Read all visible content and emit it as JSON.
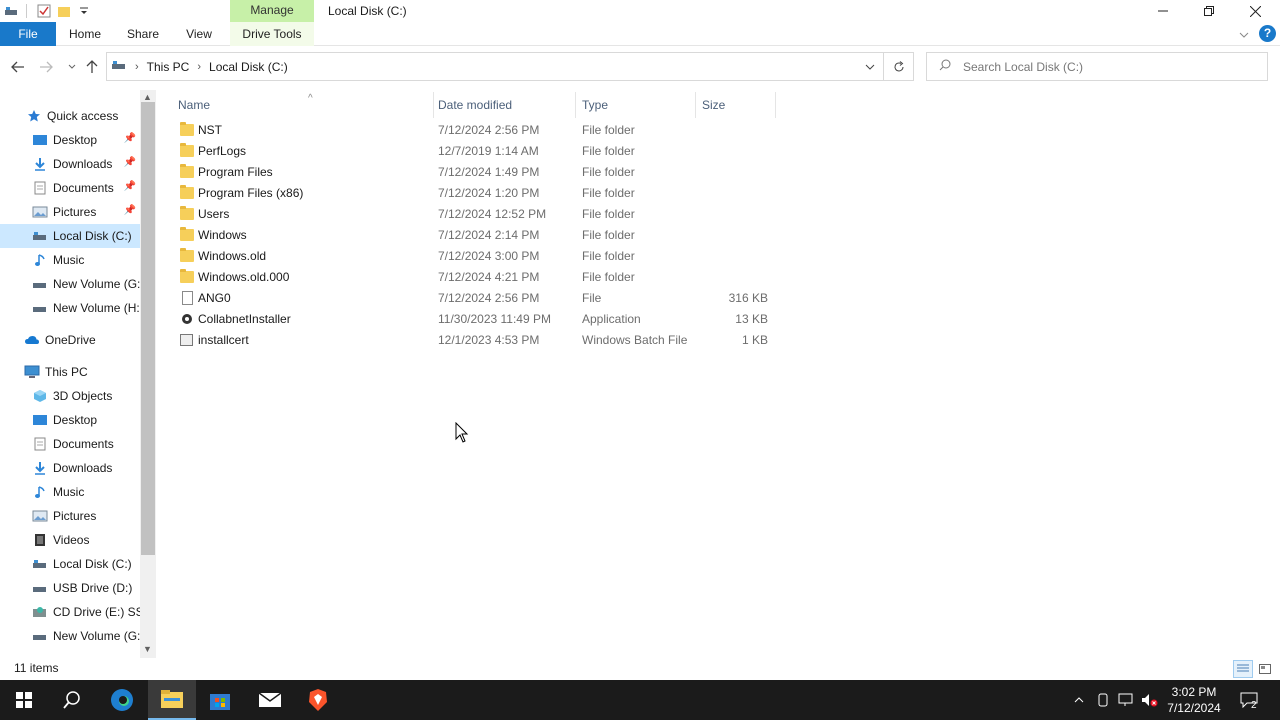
{
  "titlebar": {
    "manage_tab": "Manage",
    "window_title": "Local Disk (C:)"
  },
  "ribbon": {
    "tabs": [
      {
        "label": "File"
      },
      {
        "label": "Home"
      },
      {
        "label": "Share"
      },
      {
        "label": "View"
      },
      {
        "label": "Drive Tools"
      }
    ],
    "help": "?"
  },
  "address": {
    "crumbs": [
      "This PC",
      "Local Disk (C:)"
    ],
    "search_placeholder": "Search Local Disk (C:)"
  },
  "nav": {
    "items": [
      {
        "label": "Quick access",
        "icon": "star-icon"
      },
      {
        "label": "Desktop",
        "icon": "desktop-icon",
        "pinned": true
      },
      {
        "label": "Downloads",
        "icon": "download-icon",
        "pinned": true
      },
      {
        "label": "Documents",
        "icon": "document-icon",
        "pinned": true
      },
      {
        "label": "Pictures",
        "icon": "pictures-icon",
        "pinned": true
      },
      {
        "label": "Local Disk (C:)",
        "icon": "drive-icon",
        "selected": true
      },
      {
        "label": "Music",
        "icon": "music-icon"
      },
      {
        "label": "New Volume (G:",
        "icon": "drive-icon"
      },
      {
        "label": "New Volume (H:",
        "icon": "drive-icon"
      },
      {
        "label": "OneDrive",
        "icon": "cloud-icon"
      },
      {
        "label": "This PC",
        "icon": "computer-icon"
      },
      {
        "label": "3D Objects",
        "icon": "cube-icon"
      },
      {
        "label": "Desktop",
        "icon": "desktop-icon"
      },
      {
        "label": "Documents",
        "icon": "document-icon"
      },
      {
        "label": "Downloads",
        "icon": "download-icon"
      },
      {
        "label": "Music",
        "icon": "music-icon"
      },
      {
        "label": "Pictures",
        "icon": "pictures-icon"
      },
      {
        "label": "Videos",
        "icon": "video-icon"
      },
      {
        "label": "Local Disk (C:)",
        "icon": "drive-icon"
      },
      {
        "label": "USB Drive (D:)",
        "icon": "usb-icon"
      },
      {
        "label": "CD Drive (E:) SSS",
        "icon": "cd-icon"
      },
      {
        "label": "New Volume (G:",
        "icon": "drive-icon"
      }
    ]
  },
  "columns": {
    "name": "Name",
    "date": "Date modified",
    "type": "Type",
    "size": "Size"
  },
  "files": [
    {
      "name": "NST",
      "date": "7/12/2024 2:56 PM",
      "type": "File folder",
      "size": "",
      "kind": "folder"
    },
    {
      "name": "PerfLogs",
      "date": "12/7/2019 1:14 AM",
      "type": "File folder",
      "size": "",
      "kind": "folder"
    },
    {
      "name": "Program Files",
      "date": "7/12/2024 1:49 PM",
      "type": "File folder",
      "size": "",
      "kind": "folder"
    },
    {
      "name": "Program Files (x86)",
      "date": "7/12/2024 1:20 PM",
      "type": "File folder",
      "size": "",
      "kind": "folder"
    },
    {
      "name": "Users",
      "date": "7/12/2024 12:52 PM",
      "type": "File folder",
      "size": "",
      "kind": "folder"
    },
    {
      "name": "Windows",
      "date": "7/12/2024 2:14 PM",
      "type": "File folder",
      "size": "",
      "kind": "folder"
    },
    {
      "name": "Windows.old",
      "date": "7/12/2024 3:00 PM",
      "type": "File folder",
      "size": "",
      "kind": "folder"
    },
    {
      "name": "Windows.old.000",
      "date": "7/12/2024 4:21 PM",
      "type": "File folder",
      "size": "",
      "kind": "folder"
    },
    {
      "name": "ANG0",
      "date": "7/12/2024 2:56 PM",
      "type": "File",
      "size": "316 KB",
      "kind": "file"
    },
    {
      "name": "CollabnetInstaller",
      "date": "11/30/2023 11:49 PM",
      "type": "Application",
      "size": "13 KB",
      "kind": "app"
    },
    {
      "name": "installcert",
      "date": "12/1/2023 4:53 PM",
      "type": "Windows Batch File",
      "size": "1 KB",
      "kind": "bat"
    }
  ],
  "status": {
    "item_count": "11 items"
  },
  "taskbar": {
    "time": "3:02 PM",
    "date": "7/12/2024",
    "notification_count": "2"
  }
}
